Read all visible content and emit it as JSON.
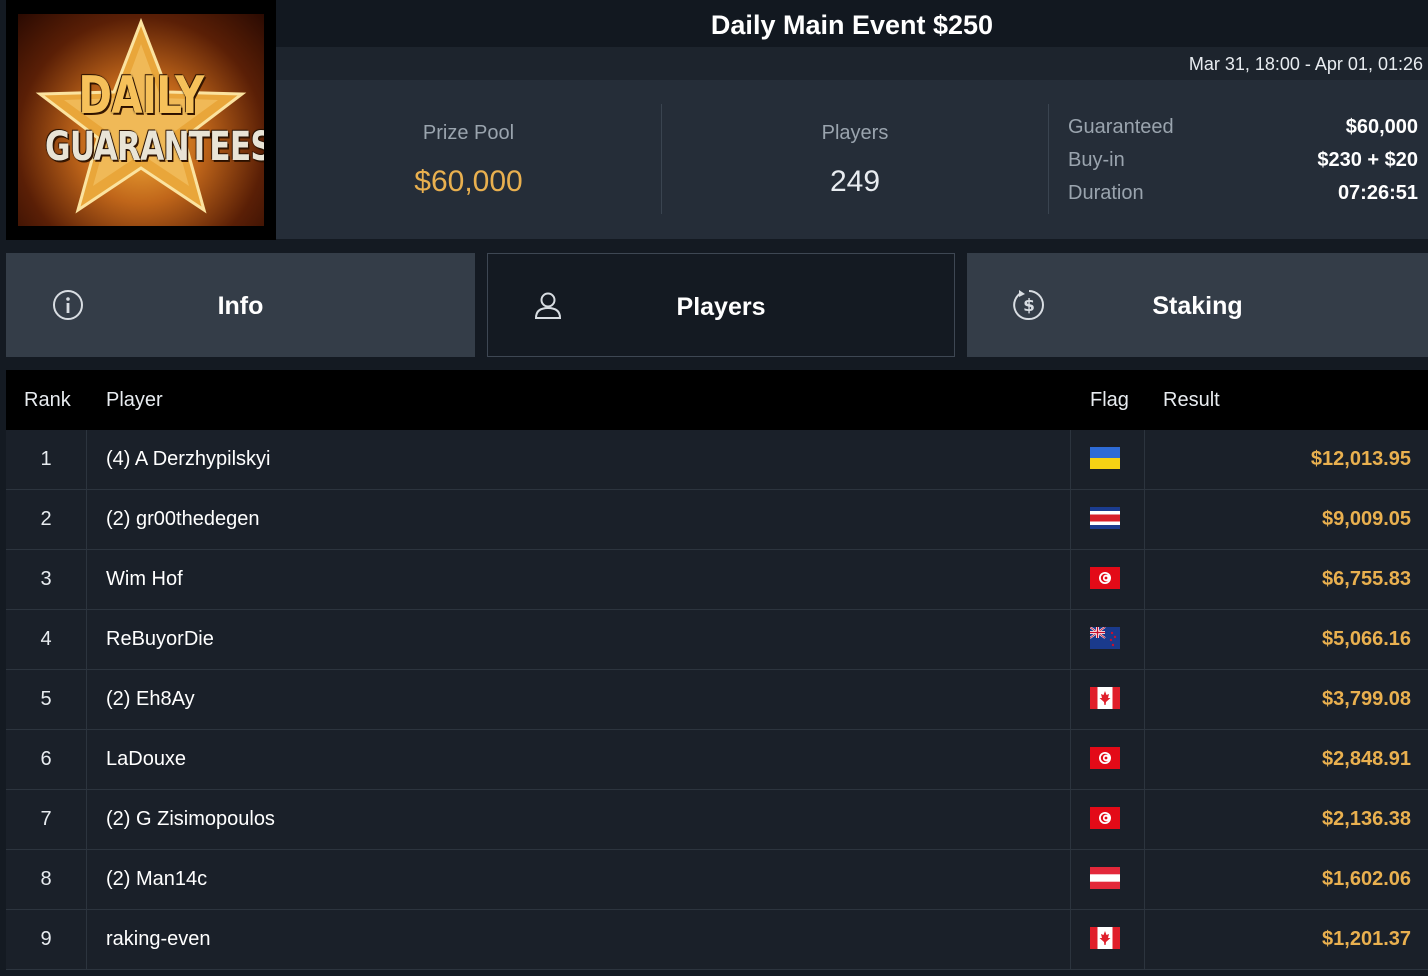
{
  "logo": {
    "line1": "DAILY",
    "line2": "GUARANTEES"
  },
  "header": {
    "title": "Daily Main Event $250",
    "dates": "Mar 31, 18:00 - Apr 01, 01:26"
  },
  "stats": {
    "prize_pool_label": "Prize Pool",
    "prize_pool_value": "$60,000",
    "players_label": "Players",
    "players_value": "249"
  },
  "details": [
    {
      "label": "Guaranteed",
      "value": "$60,000"
    },
    {
      "label": "Buy-in",
      "value": "$230 + $20"
    },
    {
      "label": "Duration",
      "value": "07:26:51"
    }
  ],
  "tabs": [
    {
      "label": "Info",
      "icon": "info-icon",
      "active": false
    },
    {
      "label": "Players",
      "icon": "user-icon",
      "active": true
    },
    {
      "label": "Staking",
      "icon": "dollar-cycle-icon",
      "active": false
    }
  ],
  "table": {
    "headers": {
      "rank": "Rank",
      "player": "Player",
      "flag": "Flag",
      "result": "Result"
    },
    "rows": [
      {
        "rank": "1",
        "player": "(4) A Derzhypilskyi",
        "flag": "ukraine",
        "result": "$12,013.95"
      },
      {
        "rank": "2",
        "player": "(2) gr00thedegen",
        "flag": "costa-rica",
        "result": "$9,009.05"
      },
      {
        "rank": "3",
        "player": "Wim Hof",
        "flag": "tunisia",
        "result": "$6,755.83"
      },
      {
        "rank": "4",
        "player": "ReBuyorDie",
        "flag": "new-zealand",
        "result": "$5,066.16"
      },
      {
        "rank": "5",
        "player": "(2) Eh8Ay",
        "flag": "canada",
        "result": "$3,799.08"
      },
      {
        "rank": "6",
        "player": "LaDouxe",
        "flag": "tunisia",
        "result": "$2,848.91"
      },
      {
        "rank": "7",
        "player": "(2) G Zisimopoulos",
        "flag": "tunisia",
        "result": "$2,136.38"
      },
      {
        "rank": "8",
        "player": "(2) Man14c",
        "flag": "austria",
        "result": "$1,602.06"
      },
      {
        "rank": "9",
        "player": "raking-even",
        "flag": "canada",
        "result": "$1,201.37"
      }
    ]
  },
  "colors": {
    "accent_gold": "#e9b04f",
    "background": "#141a22",
    "tab_inactive": "#343d48"
  }
}
